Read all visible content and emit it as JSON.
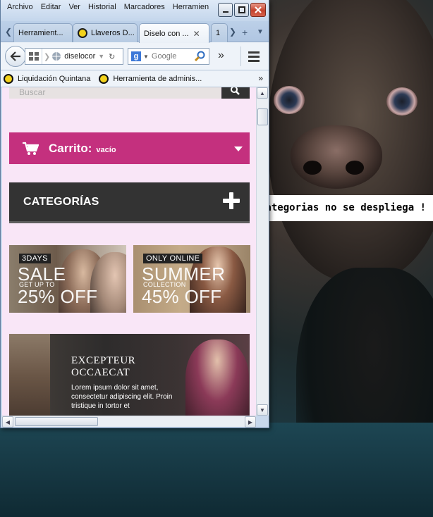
{
  "menubar": {
    "items": [
      "Archivo",
      "Editar",
      "Ver",
      "Historial",
      "Marcadores",
      "Herramien"
    ]
  },
  "tabs": [
    {
      "label": "Herramient..."
    },
    {
      "label": "Llaveros D..."
    },
    {
      "label": "Diselo con ...",
      "active": true
    },
    {
      "label": "1"
    }
  ],
  "navbar": {
    "url": "diselocor",
    "search_placeholder": "Google",
    "search_engine_letter": "g"
  },
  "bookmarks": [
    {
      "label": "Liquidación Quintana"
    },
    {
      "label": "Herramienta de adminis..."
    }
  ],
  "page": {
    "search_placeholder": "Buscar",
    "cart_label": "Carrito:",
    "cart_state": "vacío",
    "categories_label": "CATEGORÍAS",
    "banners": [
      {
        "tag": "3DAYS",
        "big": "SALE",
        "small": "GET UP TO",
        "off": "25% OFF"
      },
      {
        "tag": "ONLY ONLINE",
        "big": "SUMMER",
        "small": "COLLECTION",
        "off": "45% OFF"
      }
    ],
    "promo_title": "EXCEPTEUR\nOCCAECAT",
    "promo_text": "Lorem ipsum dolor sit amet, consectetur adipiscing elit. Proin tristique in tortor et"
  },
  "annotation": "Categorias no se despliega !",
  "colors": {
    "cart_bg": "#c4307e",
    "categories_bg": "#333333",
    "page_bg": "#f9e6f7"
  }
}
